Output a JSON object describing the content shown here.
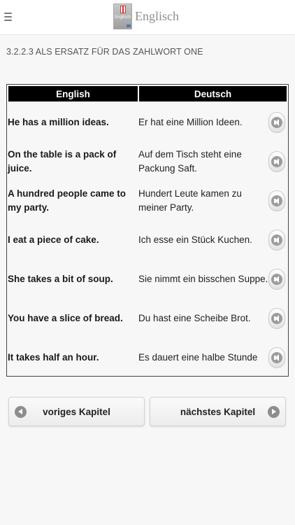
{
  "header": {
    "menu_icon": "hamburger-icon",
    "logo_icon": "englisch-app-logo",
    "logo_text": "Englisch",
    "title": "Englisch"
  },
  "section": {
    "heading": "3.2.2.3 ALS ERSATZ FÜR DAS ZAHLWORT ONE"
  },
  "table": {
    "headers": [
      "English",
      "Deutsch"
    ],
    "rows": [
      {
        "en": "He has a million ideas.",
        "de": "Er hat eine Million Ideen.",
        "audio_icon": "speaker-icon"
      },
      {
        "en": "On the table is a pack of juice.",
        "de": "Auf dem Tisch steht eine Packung Saft.",
        "audio_icon": "speaker-icon"
      },
      {
        "en": "A hundred people came to my party.",
        "de": "Hundert Leute kamen zu meiner Party.",
        "audio_icon": "speaker-icon"
      },
      {
        "en": "I eat a piece of cake.",
        "de": "Ich esse ein Stück Kuchen.",
        "audio_icon": "speaker-icon"
      },
      {
        "en": "She takes a bit of soup.",
        "de": "Sie nimmt ein bisschen Suppe.",
        "audio_icon": "speaker-icon"
      },
      {
        "en": "You have a slice of bread.",
        "de": "Du hast eine Scheibe Brot.",
        "audio_icon": "speaker-icon"
      },
      {
        "en": "It takes half an hour.",
        "de": "Es dauert eine halbe Stunde",
        "audio_icon": "speaker-icon"
      }
    ]
  },
  "navigation": {
    "prev_label": "voriges Kapitel",
    "next_label": "nächstes Kapitel",
    "prev_icon": "arrow-left-circle-icon",
    "next_icon": "arrow-right-circle-icon"
  },
  "colors": {
    "header_bg": "#ffffff",
    "page_bg": "#f7f7f7",
    "table_header_bg": "#000000",
    "table_header_text": "#ffffff",
    "icon_gray": "#8d8d8d"
  }
}
